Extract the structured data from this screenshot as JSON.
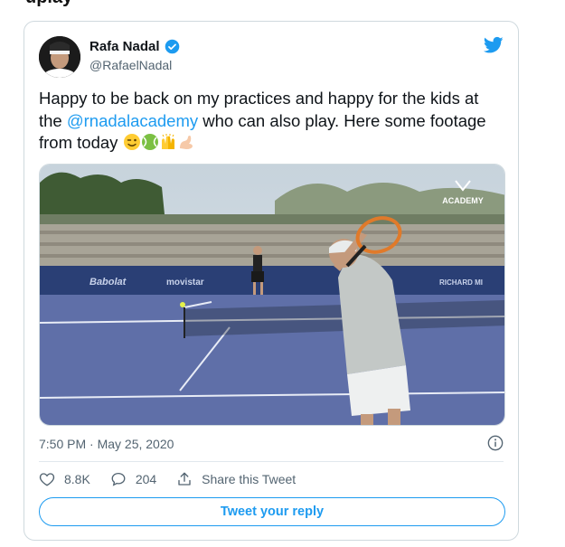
{
  "clipped_header": "uplay",
  "author": {
    "name": "Rafa Nadal",
    "handle": "@RafaelNadal"
  },
  "tweet": {
    "text_before": "Happy to be back on my practices and happy for the kids at the ",
    "mention": "@rnadalacademy",
    "text_after": " who can also play. Here some footage from today ",
    "emojis": [
      "winking-face",
      "tennis-ball",
      "raising-hands",
      "flexed-biceps"
    ]
  },
  "media": {
    "watermark": "ACADEMY",
    "banners": [
      "Babolat",
      "movistar",
      "RICHARD MI"
    ]
  },
  "timestamp": "7:50 PM · May 25, 2020",
  "stats": {
    "likes": "8.8K",
    "replies": "204",
    "share_label": "Share this Tweet"
  },
  "reply_button": "Tweet your reply",
  "colors": {
    "accent": "#1d9bf0",
    "text": "#0f1419",
    "muted": "#536471",
    "border": "#cfd9de"
  }
}
